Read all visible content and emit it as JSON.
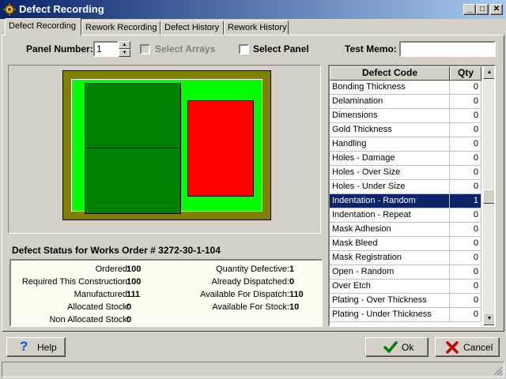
{
  "window": {
    "title": "Defect Recording",
    "icon": "gear-icon",
    "controls": {
      "minimize": "_",
      "maximize": "□",
      "close": "✕"
    }
  },
  "tabs": [
    {
      "label": "Defect Recording",
      "active": true
    },
    {
      "label": "Rework Recording",
      "active": false
    },
    {
      "label": "Defect History",
      "active": false
    },
    {
      "label": "Rework History",
      "active": false
    }
  ],
  "controls": {
    "panel_number_label": "Panel Number:",
    "panel_number_value": "1",
    "select_arrays_label": "Select Arrays",
    "select_arrays_checked": false,
    "select_arrays_enabled": false,
    "select_panel_label": "Select Panel",
    "select_panel_checked": false,
    "test_memo_label": "Test Memo:",
    "test_memo_value": ""
  },
  "panel_colors": {
    "frame": "#808000",
    "board": "#00ff00",
    "array_ok": "#008000",
    "array_defect": "#ff0000"
  },
  "status": {
    "title": "Defect Status for Works Order # 3272-30-1-104",
    "left": [
      {
        "label": "Ordered:",
        "value": "100"
      },
      {
        "label": "Required This Construction:",
        "value": "100"
      },
      {
        "label": "Manufactured:",
        "value": "111"
      },
      {
        "label": "Allocated Stock:",
        "value": "0"
      },
      {
        "label": "Non Allocated Stock:",
        "value": "0"
      }
    ],
    "right": [
      {
        "label": "Quantity Defective:",
        "value": "1"
      },
      {
        "label": "Already Dispatched:",
        "value": "0"
      },
      {
        "label": "Available For Dispatch:",
        "value": "110"
      },
      {
        "label": "Available For Stock:",
        "value": "10"
      }
    ]
  },
  "grid": {
    "headers": {
      "code": "Defect Code",
      "qty": "Qty"
    },
    "rows": [
      {
        "code": "Bonding Thickness",
        "qty": "0"
      },
      {
        "code": "Delamination",
        "qty": "0"
      },
      {
        "code": "Dimensions",
        "qty": "0"
      },
      {
        "code": "Gold Thickness",
        "qty": "0"
      },
      {
        "code": "Handling",
        "qty": "0"
      },
      {
        "code": "Holes - Damage",
        "qty": "0"
      },
      {
        "code": "Holes - Over Size",
        "qty": "0"
      },
      {
        "code": "Holes - Under Size",
        "qty": "0"
      },
      {
        "code": "Indentation - Random",
        "qty": "1",
        "selected": true
      },
      {
        "code": "Indentation - Repeat",
        "qty": "0"
      },
      {
        "code": "Mask Adhesion",
        "qty": "0"
      },
      {
        "code": "Mask Bleed",
        "qty": "0"
      },
      {
        "code": "Mask Registration",
        "qty": "0"
      },
      {
        "code": "Open - Random",
        "qty": "0"
      },
      {
        "code": "Over Etch",
        "qty": "0"
      },
      {
        "code": "Plating - Over Thickness",
        "qty": "0"
      },
      {
        "code": "Plating - Under Thickness",
        "qty": "0"
      }
    ]
  },
  "buttons": {
    "help": "Help",
    "ok": "Ok",
    "cancel": "Cancel"
  },
  "icons": {
    "help": "question-mark-icon",
    "ok": "checkmark-icon",
    "cancel": "x-icon"
  },
  "colors": {
    "selection": "#0a246a",
    "ok_check": "#008000",
    "cancel_x": "#c00000",
    "help_q": "#0055cc"
  }
}
